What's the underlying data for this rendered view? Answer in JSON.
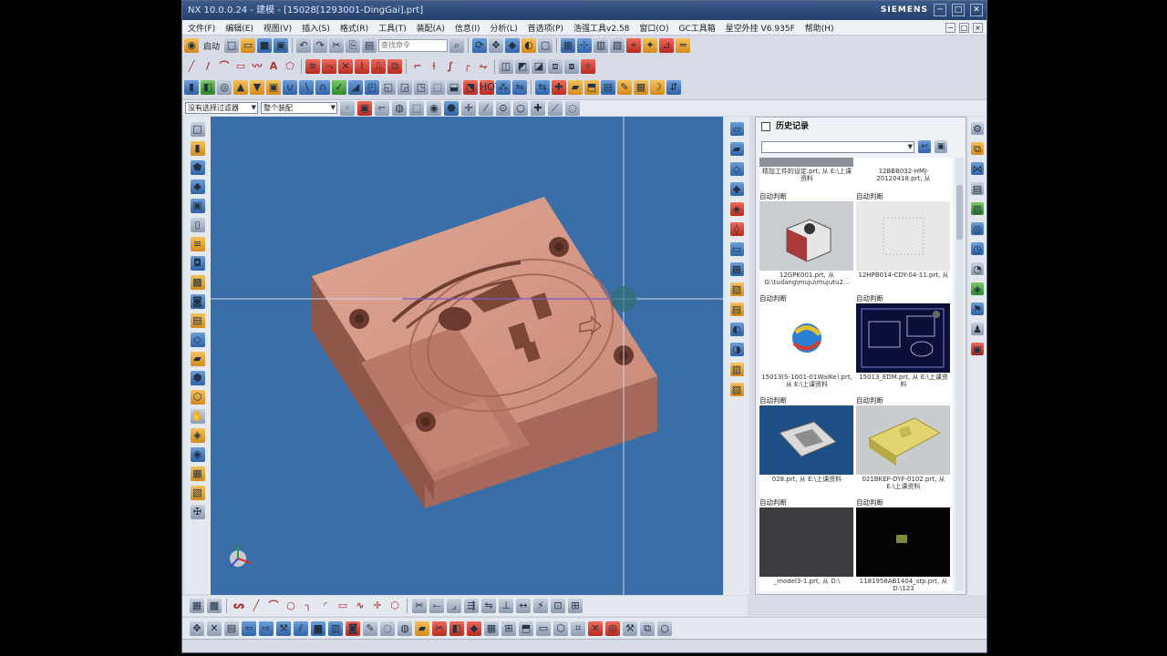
{
  "window": {
    "title": "NX 10.0.0.24 - 建模 - [15028[1293001-DingGai].prt]",
    "brand": "SIEMENS",
    "controls": [
      "─",
      "□",
      "✕"
    ]
  },
  "menubar": {
    "items": [
      "文件(F)",
      "编辑(E)",
      "视图(V)",
      "插入(S)",
      "格式(R)",
      "工具(T)",
      "装配(A)",
      "信息(I)",
      "分析(L)",
      "首选项(P)",
      "浩强工具v2.58",
      "窗口(O)",
      "GC工具箱",
      "星空外挂 V6.935F",
      "帮助(H)"
    ]
  },
  "toolbar": {
    "start_label": "启动",
    "search_placeholder": "查找命令"
  },
  "filterbar": {
    "selection_filter": "没有选择过滤器",
    "assembly_scope": "整个装配"
  },
  "colors": {
    "viewport_bg": "#3a6ea8",
    "part_top": "#d89a88",
    "part_side": "#8f5a4c",
    "part_front": "#a86a5a"
  },
  "history": {
    "title": "历史记录",
    "top_row": [
      {
        "caption": "精加工件的设定.prt, 从 E:\\上课资料"
      },
      {
        "caption": "12BBB032-HMJ-20120418.prt, 从"
      }
    ],
    "rows": [
      [
        {
          "label": "自动判断",
          "caption": "12GPK001.prt, 从 G:\\tudang\\muju\\mujutu2...",
          "kind": "mold"
        },
        {
          "label": "自动判断",
          "caption": "12HPB014-CDY-04-11.prt, 从",
          "kind": "blank"
        }
      ],
      [
        {
          "label": "自动判断",
          "caption": "15013(S-1001-01WaiKe).prt, 从 E:\\上课资料",
          "kind": "nxlogo"
        },
        {
          "label": "自动判断",
          "caption": "15013_EDM.prt, 从 E:\\上课资料",
          "kind": "drawing"
        }
      ],
      [
        {
          "label": "自动判断",
          "caption": "028.prt, 从 E:\\上课资料",
          "kind": "cavity"
        },
        {
          "label": "自动判断",
          "caption": "021BKEF-DYF-0102.prt, 从 E:\\上课资料",
          "kind": "yellow"
        }
      ],
      [
        {
          "label": "自动判断",
          "caption": "_model3-1.prt, 从 D:\\",
          "kind": "dark"
        },
        {
          "label": "自动判断",
          "caption": "1181958AB1404_stp.prt, 从 D:\\123",
          "kind": "black"
        }
      ]
    ]
  }
}
